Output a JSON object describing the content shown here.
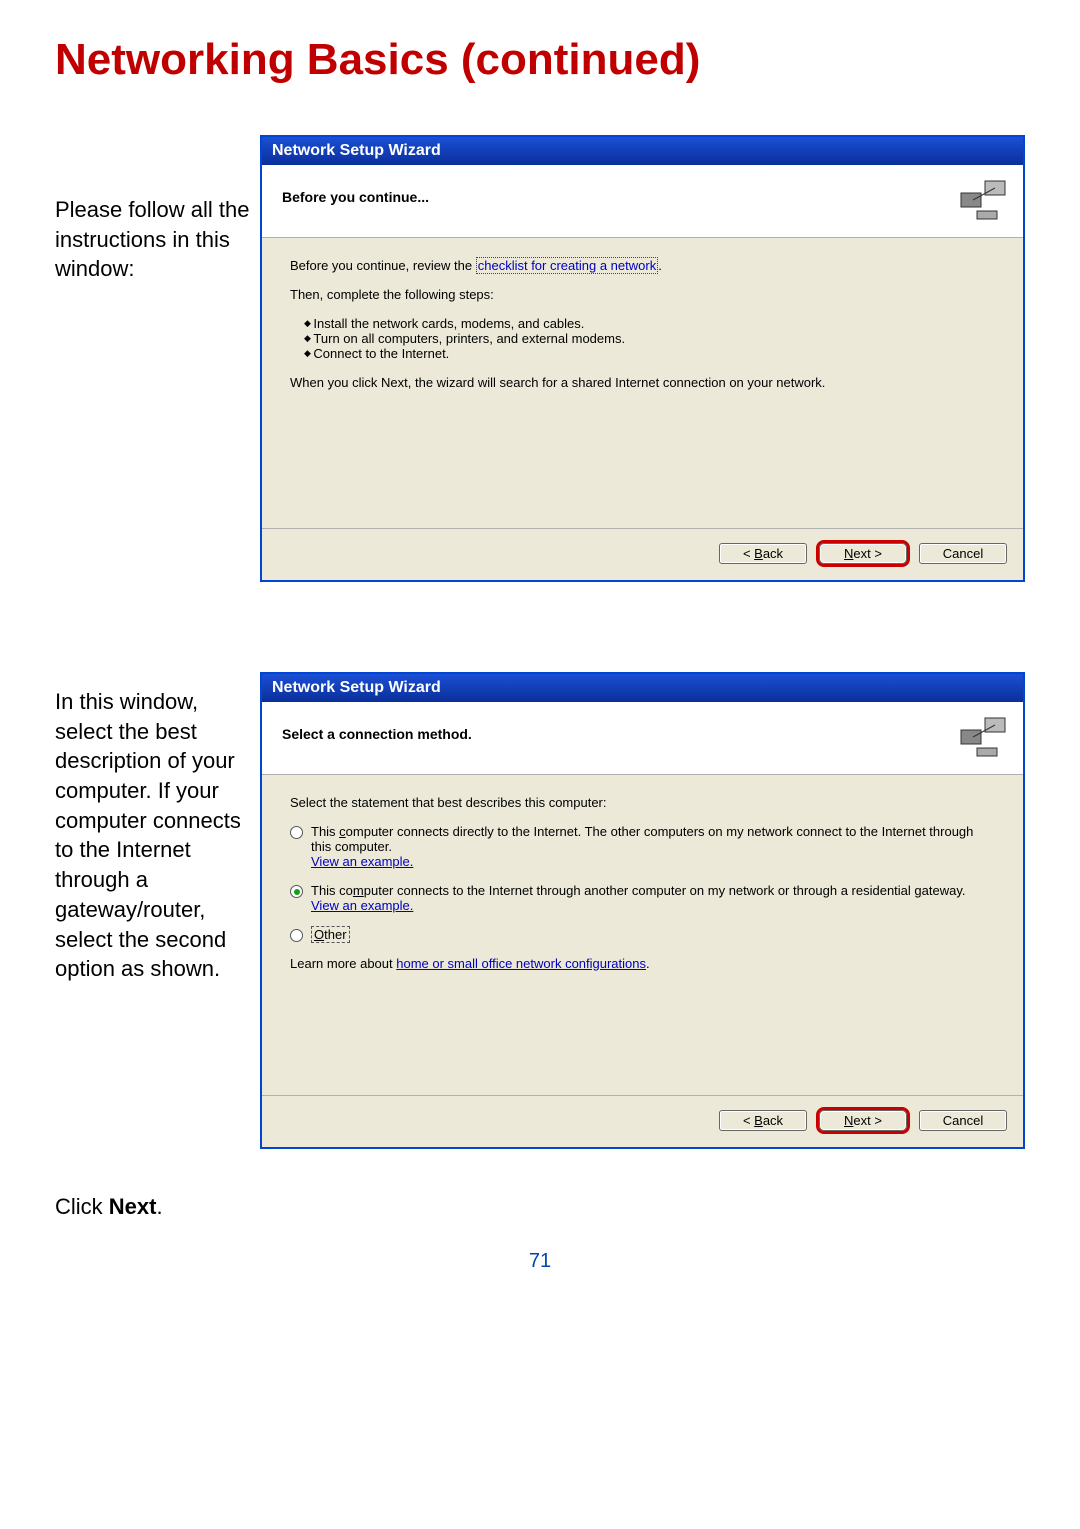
{
  "page": {
    "title": "Networking Basics (continued)",
    "number": "71"
  },
  "section1": {
    "sidetext": "Please follow all the instructions in this window:",
    "wizard": {
      "title": "Network Setup Wizard",
      "header": "Before you continue...",
      "body": {
        "line1_pre": "Before you continue, review the ",
        "checklist_link": "checklist for creating a network",
        "line1_post": ".",
        "line2": "Then, complete the following steps:",
        "steps": [
          "Install the network cards, modems, and cables.",
          "Turn on all computers, printers, and external modems.",
          "Connect to the Internet."
        ],
        "line3": "When you click Next, the wizard will search for a shared Internet connection on your network."
      },
      "buttons": {
        "back": "< Back",
        "next": "Next >",
        "cancel": "Cancel"
      }
    }
  },
  "section2": {
    "sidetext": "In this window, select the best description of your computer. If your computer connects to the Internet through a gateway/router, select the second option as shown.",
    "clicknext_pre": "Click ",
    "clicknext_bold": "Next",
    "clicknext_post": ".",
    "wizard": {
      "title": "Network Setup Wizard",
      "header": "Select a connection method.",
      "body": {
        "intro": "Select the statement that best describes this computer:",
        "opt1": "This computer connects directly to the Internet. The other computers on my network connect to the Internet through this computer.",
        "view1": "View an example.",
        "opt2": "This computer connects to the Internet through another computer on my network or through a residential gateway.",
        "view2": "View an example.",
        "opt3": "Other",
        "learn_pre": "Learn more about ",
        "learn_link": "home or small office network configurations",
        "learn_post": "."
      },
      "buttons": {
        "back": "< Back",
        "next": "Next >",
        "cancel": "Cancel"
      }
    }
  }
}
